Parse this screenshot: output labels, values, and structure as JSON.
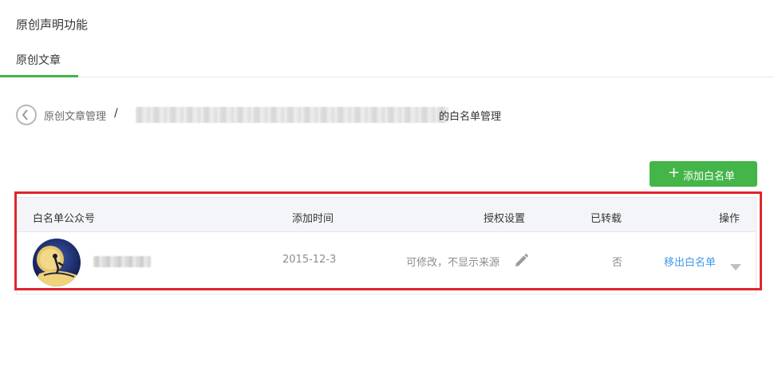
{
  "page": {
    "title": "原创声明功能"
  },
  "tabs": [
    {
      "label": "原创文章",
      "active": true
    }
  ],
  "breadcrumb": {
    "link_label": "原创文章管理",
    "separator": "/",
    "suffix": "的白名单管理"
  },
  "toolbar": {
    "add_button_label": "添加白名单",
    "add_button_icon": "plus-icon"
  },
  "table": {
    "headers": {
      "account": "白名单公众号",
      "time": "添加时间",
      "auth": "授权设置",
      "reposted": "已转载",
      "action": "操作"
    },
    "rows": [
      {
        "added_time": "2015-12-3",
        "auth_setting": "可修改，不显示来源",
        "reposted": "否",
        "action_label": "移出白名单"
      }
    ]
  },
  "colors": {
    "accent_green": "#44b549",
    "link_blue": "#459ae9",
    "highlight_red": "#e0262b"
  }
}
